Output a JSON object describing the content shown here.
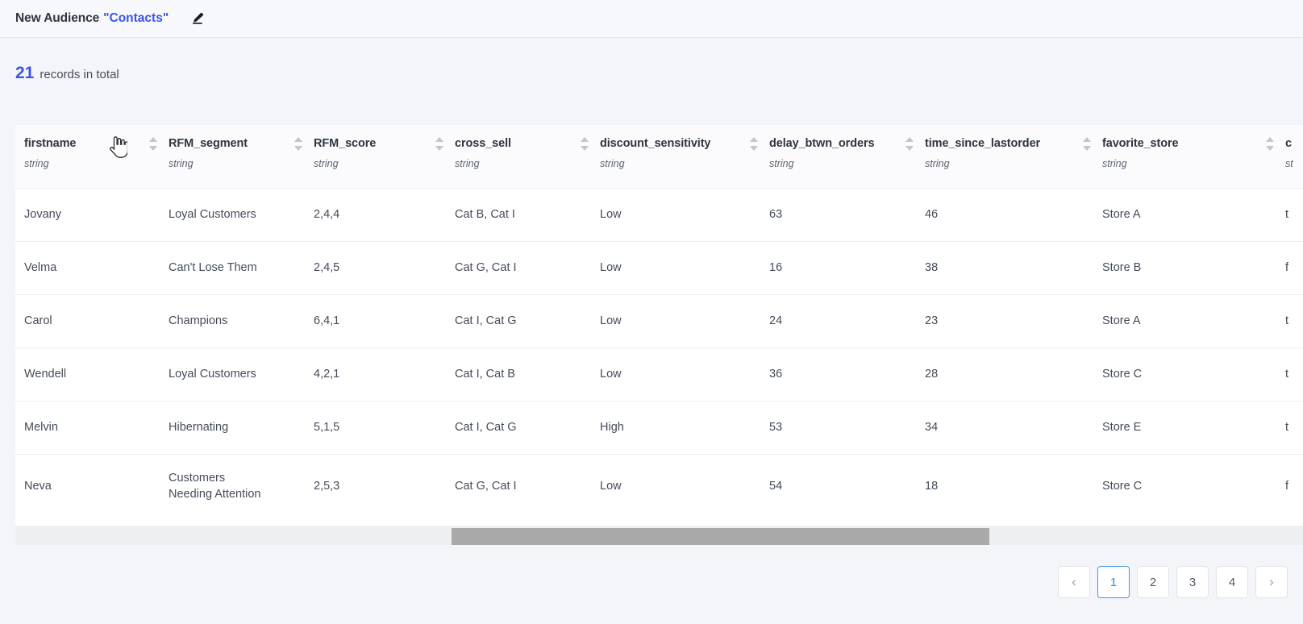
{
  "header": {
    "title_prefix": "New Audience",
    "title_quoted": "\"Contacts\"",
    "edit_icon": "pencil-icon",
    "accent_blue": "#3b53e8"
  },
  "records": {
    "count": "21",
    "label": "records in total"
  },
  "table": {
    "type_label": "string",
    "sort_icon": "sort-updown-icon",
    "columns": [
      {
        "name": "firstname",
        "type": "string"
      },
      {
        "name": "RFM_segment",
        "type": "string"
      },
      {
        "name": "RFM_score",
        "type": "string"
      },
      {
        "name": "cross_sell",
        "type": "string"
      },
      {
        "name": "discount_sensitivity",
        "type": "string"
      },
      {
        "name": "delay_btwn_orders",
        "type": "string"
      },
      {
        "name": "time_since_lastorder",
        "type": "string"
      },
      {
        "name": "favorite_store",
        "type": "string"
      },
      {
        "name": "c",
        "type": "st"
      }
    ],
    "rows": [
      {
        "firstname": "Jovany",
        "RFM_segment": "Loyal Customers",
        "RFM_score": "2,4,4",
        "cross_sell": "Cat B, Cat I",
        "discount_sensitivity": "Low",
        "delay_btwn_orders": "63",
        "time_since_lastorder": "46",
        "favorite_store": "Store A",
        "c": "t"
      },
      {
        "firstname": "Velma",
        "RFM_segment": "Can't Lose Them",
        "RFM_score": "2,4,5",
        "cross_sell": "Cat G, Cat I",
        "discount_sensitivity": "Low",
        "delay_btwn_orders": "16",
        "time_since_lastorder": "38",
        "favorite_store": "Store B",
        "c": "f"
      },
      {
        "firstname": "Carol",
        "RFM_segment": "Champions",
        "RFM_score": "6,4,1",
        "cross_sell": "Cat I, Cat G",
        "discount_sensitivity": "Low",
        "delay_btwn_orders": "24",
        "time_since_lastorder": "23",
        "favorite_store": "Store A",
        "c": "t"
      },
      {
        "firstname": "Wendell",
        "RFM_segment": "Loyal Customers",
        "RFM_score": "4,2,1",
        "cross_sell": "Cat I, Cat B",
        "discount_sensitivity": "Low",
        "delay_btwn_orders": "36",
        "time_since_lastorder": "28",
        "favorite_store": "Store C",
        "c": "t"
      },
      {
        "firstname": "Melvin",
        "RFM_segment": "Hibernating",
        "RFM_score": "5,1,5",
        "cross_sell": "Cat I, Cat G",
        "discount_sensitivity": "High",
        "delay_btwn_orders": "53",
        "time_since_lastorder": "34",
        "favorite_store": "Store E",
        "c": "t"
      },
      {
        "firstname": "Neva",
        "RFM_segment": "Customers\nNeeding Attention",
        "RFM_score": "2,5,3",
        "cross_sell": "Cat G, Cat I",
        "discount_sensitivity": "Low",
        "delay_btwn_orders": "54",
        "time_since_lastorder": "18",
        "favorite_store": "Store C",
        "c": "f"
      }
    ]
  },
  "scrollbar": {
    "orientation": "horizontal",
    "thumb_color": "#a9a9a9",
    "track_color": "#eeeff1"
  },
  "pagination": {
    "prev_label": "‹",
    "next_label": "›",
    "pages": [
      "1",
      "2",
      "3",
      "4"
    ],
    "active_page": "1",
    "active_color": "#2f8ddb"
  },
  "cursor": {
    "type": "pointing-hand-cursor"
  }
}
